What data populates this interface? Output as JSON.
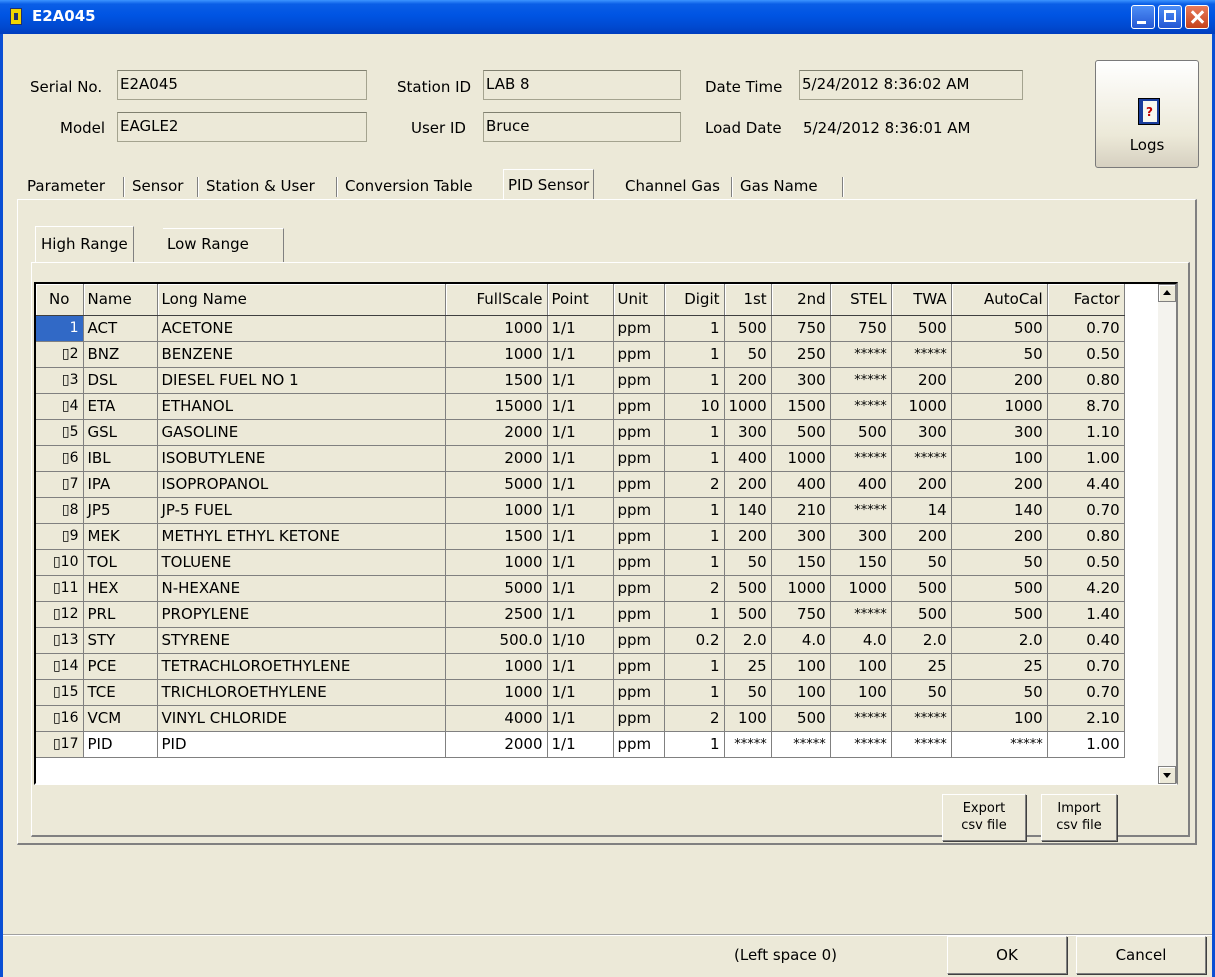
{
  "window": {
    "title": "E2A045"
  },
  "header": {
    "serial_label": "Serial No.",
    "serial_value": "E2A045",
    "model_label": "Model",
    "model_value": "EAGLE2",
    "station_label": "Station ID",
    "station_value": "LAB 8",
    "user_label": "User ID",
    "user_value": "Bruce",
    "datetime_label": "Date Time",
    "datetime_value": "5/24/2012 8:36:02 AM",
    "loaddate_label": "Load Date",
    "loaddate_value": "5/24/2012 8:36:01 AM"
  },
  "logs_button": {
    "label": "Logs",
    "icon": "logs-book-icon"
  },
  "tabs": [
    "Parameter",
    "Sensor",
    "Station & User",
    "Conversion Table",
    "PID Sensor",
    "Channel Gas",
    "Gas Name"
  ],
  "active_tab": "PID Sensor",
  "subtabs": [
    "High Range",
    "Low Range"
  ],
  "active_subtab": "High Range",
  "grid": {
    "columns": [
      "No",
      "Name",
      "Long Name",
      "FullScale",
      "Point",
      "Unit",
      "Digit",
      "1st",
      "2nd",
      "STEL",
      "TWA",
      "AutoCal",
      "Factor"
    ],
    "rows": [
      [
        "1",
        "ACT",
        "ACETONE",
        "1000",
        "1/1",
        "ppm",
        "1",
        "500",
        "750",
        "750",
        "500",
        "500",
        "0.70"
      ],
      [
        "▯2",
        "BNZ",
        "BENZENE",
        "1000",
        "1/1",
        "ppm",
        "1",
        "50",
        "250",
        "*****",
        "*****",
        "50",
        "0.50"
      ],
      [
        "▯3",
        "DSL",
        "DIESEL FUEL NO 1",
        "1500",
        "1/1",
        "ppm",
        "1",
        "200",
        "300",
        "*****",
        "200",
        "200",
        "0.80"
      ],
      [
        "▯4",
        "ETA",
        "ETHANOL",
        "15000",
        "1/1",
        "ppm",
        "10",
        "1000",
        "1500",
        "*****",
        "1000",
        "1000",
        "8.70"
      ],
      [
        "▯5",
        "GSL",
        "GASOLINE",
        "2000",
        "1/1",
        "ppm",
        "1",
        "300",
        "500",
        "500",
        "300",
        "300",
        "1.10"
      ],
      [
        "▯6",
        "IBL",
        "ISOBUTYLENE",
        "2000",
        "1/1",
        "ppm",
        "1",
        "400",
        "1000",
        "*****",
        "*****",
        "100",
        "1.00"
      ],
      [
        "▯7",
        "IPA",
        "ISOPROPANOL",
        "5000",
        "1/1",
        "ppm",
        "2",
        "200",
        "400",
        "400",
        "200",
        "200",
        "4.40"
      ],
      [
        "▯8",
        "JP5",
        "JP-5 FUEL",
        "1000",
        "1/1",
        "ppm",
        "1",
        "140",
        "210",
        "*****",
        "14",
        "140",
        "0.70"
      ],
      [
        "▯9",
        "MEK",
        "METHYL ETHYL KETONE",
        "1500",
        "1/1",
        "ppm",
        "1",
        "200",
        "300",
        "300",
        "200",
        "200",
        "0.80"
      ],
      [
        "▯10",
        "TOL",
        "TOLUENE",
        "1000",
        "1/1",
        "ppm",
        "1",
        "50",
        "150",
        "150",
        "50",
        "50",
        "0.50"
      ],
      [
        "▯11",
        "HEX",
        "N-HEXANE",
        "5000",
        "1/1",
        "ppm",
        "2",
        "500",
        "1000",
        "1000",
        "500",
        "500",
        "4.20"
      ],
      [
        "▯12",
        "PRL",
        "PROPYLENE",
        "2500",
        "1/1",
        "ppm",
        "1",
        "500",
        "750",
        "*****",
        "500",
        "500",
        "1.40"
      ],
      [
        "▯13",
        "STY",
        "STYRENE",
        "500.0",
        "1/10",
        "ppm",
        "0.2",
        "2.0",
        "4.0",
        "4.0",
        "2.0",
        "2.0",
        "0.40"
      ],
      [
        "▯14",
        "PCE",
        "TETRACHLOROETHYLENE",
        "1000",
        "1/1",
        "ppm",
        "1",
        "25",
        "100",
        "100",
        "25",
        "25",
        "0.70"
      ],
      [
        "▯15",
        "TCE",
        "TRICHLOROETHYLENE",
        "1000",
        "1/1",
        "ppm",
        "1",
        "50",
        "100",
        "100",
        "50",
        "50",
        "0.70"
      ],
      [
        "▯16",
        "VCM",
        "VINYL CHLORIDE",
        "4000",
        "1/1",
        "ppm",
        "2",
        "100",
        "500",
        "*****",
        "*****",
        "100",
        "2.10"
      ],
      [
        "▯17",
        "PID",
        "PID",
        "2000",
        "1/1",
        "ppm",
        "1",
        "*****",
        "*****",
        "*****",
        "*****",
        "*****",
        "1.00"
      ]
    ]
  },
  "export_button": {
    "line1": "Export",
    "line2": "csv file"
  },
  "import_button": {
    "line1": "Import",
    "line2": "csv file"
  },
  "status_text": "(Left space 0)",
  "ok_label": "OK",
  "cancel_label": "Cancel"
}
